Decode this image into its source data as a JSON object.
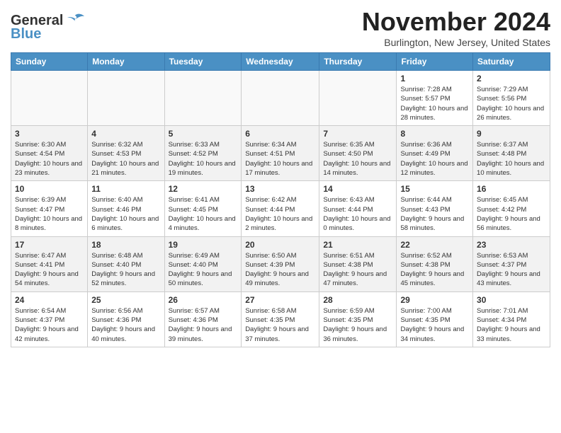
{
  "header": {
    "logo_general": "General",
    "logo_blue": "Blue",
    "month_title": "November 2024",
    "subtitle": "Burlington, New Jersey, United States"
  },
  "weekdays": [
    "Sunday",
    "Monday",
    "Tuesday",
    "Wednesday",
    "Thursday",
    "Friday",
    "Saturday"
  ],
  "weeks": [
    [
      {
        "day": "",
        "empty": true
      },
      {
        "day": "",
        "empty": true
      },
      {
        "day": "",
        "empty": true
      },
      {
        "day": "",
        "empty": true
      },
      {
        "day": "",
        "empty": true
      },
      {
        "day": "1",
        "sunrise": "Sunrise: 7:28 AM",
        "sunset": "Sunset: 5:57 PM",
        "daylight": "Daylight: 10 hours and 28 minutes."
      },
      {
        "day": "2",
        "sunrise": "Sunrise: 7:29 AM",
        "sunset": "Sunset: 5:56 PM",
        "daylight": "Daylight: 10 hours and 26 minutes."
      }
    ],
    [
      {
        "day": "3",
        "sunrise": "Sunrise: 6:30 AM",
        "sunset": "Sunset: 4:54 PM",
        "daylight": "Daylight: 10 hours and 23 minutes."
      },
      {
        "day": "4",
        "sunrise": "Sunrise: 6:32 AM",
        "sunset": "Sunset: 4:53 PM",
        "daylight": "Daylight: 10 hours and 21 minutes."
      },
      {
        "day": "5",
        "sunrise": "Sunrise: 6:33 AM",
        "sunset": "Sunset: 4:52 PM",
        "daylight": "Daylight: 10 hours and 19 minutes."
      },
      {
        "day": "6",
        "sunrise": "Sunrise: 6:34 AM",
        "sunset": "Sunset: 4:51 PM",
        "daylight": "Daylight: 10 hours and 17 minutes."
      },
      {
        "day": "7",
        "sunrise": "Sunrise: 6:35 AM",
        "sunset": "Sunset: 4:50 PM",
        "daylight": "Daylight: 10 hours and 14 minutes."
      },
      {
        "day": "8",
        "sunrise": "Sunrise: 6:36 AM",
        "sunset": "Sunset: 4:49 PM",
        "daylight": "Daylight: 10 hours and 12 minutes."
      },
      {
        "day": "9",
        "sunrise": "Sunrise: 6:37 AM",
        "sunset": "Sunset: 4:48 PM",
        "daylight": "Daylight: 10 hours and 10 minutes."
      }
    ],
    [
      {
        "day": "10",
        "sunrise": "Sunrise: 6:39 AM",
        "sunset": "Sunset: 4:47 PM",
        "daylight": "Daylight: 10 hours and 8 minutes."
      },
      {
        "day": "11",
        "sunrise": "Sunrise: 6:40 AM",
        "sunset": "Sunset: 4:46 PM",
        "daylight": "Daylight: 10 hours and 6 minutes."
      },
      {
        "day": "12",
        "sunrise": "Sunrise: 6:41 AM",
        "sunset": "Sunset: 4:45 PM",
        "daylight": "Daylight: 10 hours and 4 minutes."
      },
      {
        "day": "13",
        "sunrise": "Sunrise: 6:42 AM",
        "sunset": "Sunset: 4:44 PM",
        "daylight": "Daylight: 10 hours and 2 minutes."
      },
      {
        "day": "14",
        "sunrise": "Sunrise: 6:43 AM",
        "sunset": "Sunset: 4:44 PM",
        "daylight": "Daylight: 10 hours and 0 minutes."
      },
      {
        "day": "15",
        "sunrise": "Sunrise: 6:44 AM",
        "sunset": "Sunset: 4:43 PM",
        "daylight": "Daylight: 9 hours and 58 minutes."
      },
      {
        "day": "16",
        "sunrise": "Sunrise: 6:45 AM",
        "sunset": "Sunset: 4:42 PM",
        "daylight": "Daylight: 9 hours and 56 minutes."
      }
    ],
    [
      {
        "day": "17",
        "sunrise": "Sunrise: 6:47 AM",
        "sunset": "Sunset: 4:41 PM",
        "daylight": "Daylight: 9 hours and 54 minutes."
      },
      {
        "day": "18",
        "sunrise": "Sunrise: 6:48 AM",
        "sunset": "Sunset: 4:40 PM",
        "daylight": "Daylight: 9 hours and 52 minutes."
      },
      {
        "day": "19",
        "sunrise": "Sunrise: 6:49 AM",
        "sunset": "Sunset: 4:40 PM",
        "daylight": "Daylight: 9 hours and 50 minutes."
      },
      {
        "day": "20",
        "sunrise": "Sunrise: 6:50 AM",
        "sunset": "Sunset: 4:39 PM",
        "daylight": "Daylight: 9 hours and 49 minutes."
      },
      {
        "day": "21",
        "sunrise": "Sunrise: 6:51 AM",
        "sunset": "Sunset: 4:38 PM",
        "daylight": "Daylight: 9 hours and 47 minutes."
      },
      {
        "day": "22",
        "sunrise": "Sunrise: 6:52 AM",
        "sunset": "Sunset: 4:38 PM",
        "daylight": "Daylight: 9 hours and 45 minutes."
      },
      {
        "day": "23",
        "sunrise": "Sunrise: 6:53 AM",
        "sunset": "Sunset: 4:37 PM",
        "daylight": "Daylight: 9 hours and 43 minutes."
      }
    ],
    [
      {
        "day": "24",
        "sunrise": "Sunrise: 6:54 AM",
        "sunset": "Sunset: 4:37 PM",
        "daylight": "Daylight: 9 hours and 42 minutes."
      },
      {
        "day": "25",
        "sunrise": "Sunrise: 6:56 AM",
        "sunset": "Sunset: 4:36 PM",
        "daylight": "Daylight: 9 hours and 40 minutes."
      },
      {
        "day": "26",
        "sunrise": "Sunrise: 6:57 AM",
        "sunset": "Sunset: 4:36 PM",
        "daylight": "Daylight: 9 hours and 39 minutes."
      },
      {
        "day": "27",
        "sunrise": "Sunrise: 6:58 AM",
        "sunset": "Sunset: 4:35 PM",
        "daylight": "Daylight: 9 hours and 37 minutes."
      },
      {
        "day": "28",
        "sunrise": "Sunrise: 6:59 AM",
        "sunset": "Sunset: 4:35 PM",
        "daylight": "Daylight: 9 hours and 36 minutes."
      },
      {
        "day": "29",
        "sunrise": "Sunrise: 7:00 AM",
        "sunset": "Sunset: 4:35 PM",
        "daylight": "Daylight: 9 hours and 34 minutes."
      },
      {
        "day": "30",
        "sunrise": "Sunrise: 7:01 AM",
        "sunset": "Sunset: 4:34 PM",
        "daylight": "Daylight: 9 hours and 33 minutes."
      }
    ]
  ]
}
